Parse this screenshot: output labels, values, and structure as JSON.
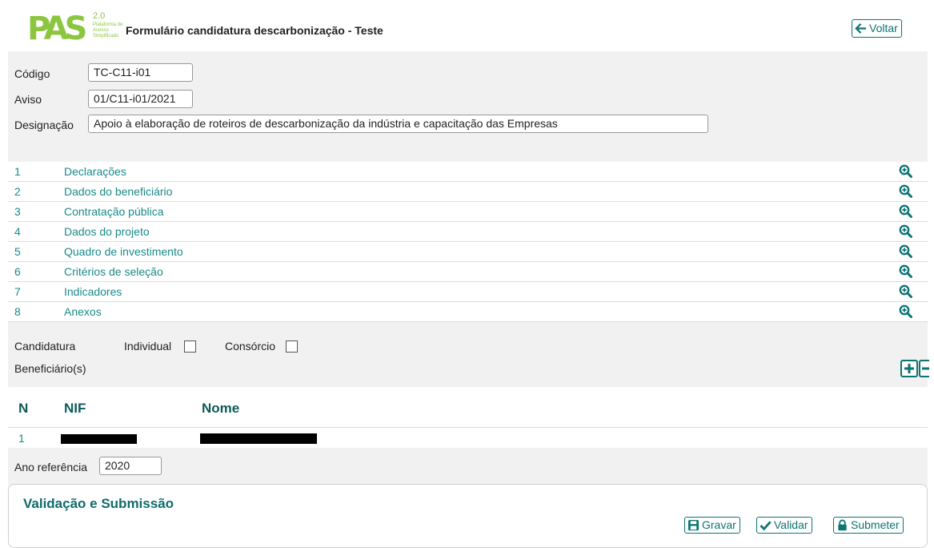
{
  "header": {
    "logo_text": "PAS",
    "logo_version": "2.0",
    "logo_subtitle": "Plataforma de Acesso Simplificado",
    "title": "Formulário candidatura descarbonização - Teste",
    "back_label": "Voltar"
  },
  "form": {
    "codigo": {
      "label": "Código",
      "value": "TC-C11-i01"
    },
    "aviso": {
      "label": "Aviso",
      "value": "01/C11-i01/2021"
    },
    "designacao": {
      "label": "Designação",
      "value": "Apoio à elaboração de roteiros de descarbonização da indústria e capacitação das Empresas"
    }
  },
  "sections": [
    {
      "num": "1",
      "name": "Declarações"
    },
    {
      "num": "2",
      "name": "Dados do beneficiário"
    },
    {
      "num": "3",
      "name": "Contratação pública"
    },
    {
      "num": "4",
      "name": "Dados do projeto"
    },
    {
      "num": "5",
      "name": "Quadro de investimento"
    },
    {
      "num": "6",
      "name": "Critérios de seleção"
    },
    {
      "num": "7",
      "name": "Indicadores"
    },
    {
      "num": "8",
      "name": "Anexos"
    }
  ],
  "candidatura": {
    "label": "Candidatura",
    "individual": "Individual",
    "consorcio": "Consórcio",
    "beneficiarios_label": "Beneficiário(s)"
  },
  "beneficiarios": {
    "columns": [
      "N",
      "NIF",
      "Nome"
    ],
    "rows": [
      {
        "n": "1"
      }
    ]
  },
  "ano": {
    "label": "Ano referência",
    "value": "2020"
  },
  "submissao": {
    "title": "Validação e Submissão",
    "gravar": "Gravar",
    "validar": "Validar",
    "submeter": "Submeter"
  },
  "colors": {
    "accent": "#0e7373",
    "link": "#1a8a8a",
    "logo": "#8cc63f"
  }
}
